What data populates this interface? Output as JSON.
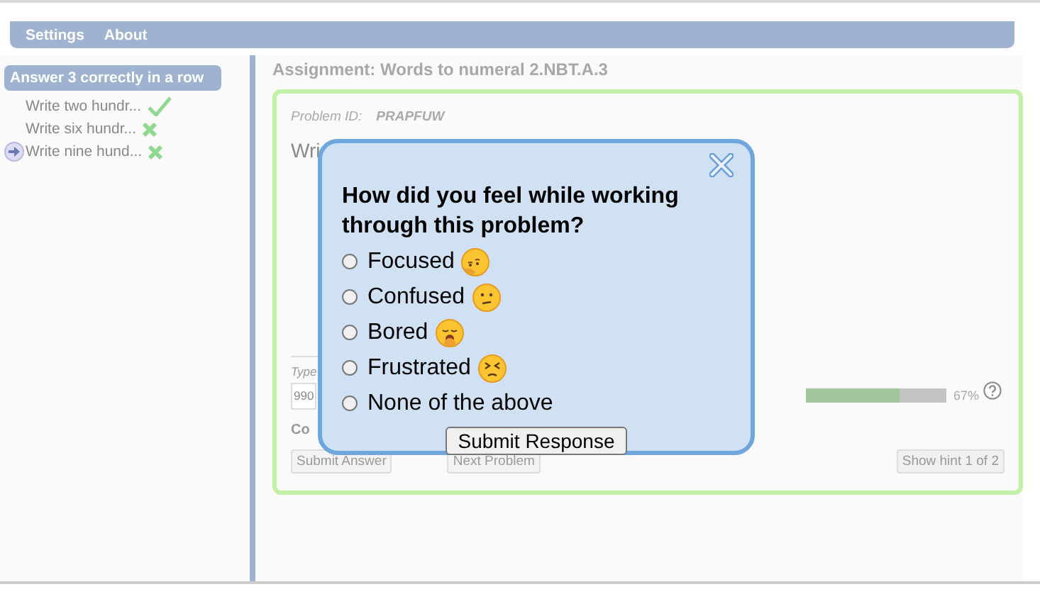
{
  "menu": [
    "Settings",
    "About"
  ],
  "sidebar": {
    "title": "Answer 3 correctly in a row",
    "items": [
      {
        "label": "Write two hundr...",
        "kind": "correct",
        "current": false
      },
      {
        "label": "Write six hundr...",
        "kind": "incorrect",
        "current": false
      },
      {
        "label": "Write nine hund...",
        "kind": "incorrect",
        "current": true
      }
    ]
  },
  "assignment": {
    "title": "Assignment: Words to numeral 2.NBT.A.3",
    "problem_id_label": "Problem ID:",
    "problem_id": "PRAPFUW",
    "question": "Wri",
    "answer_label": "Type",
    "answer_value": "990",
    "feedback": "Co",
    "progress": {
      "level": 0.67,
      "reading": "67%"
    },
    "buttons": [
      {
        "label": "Submit Answer",
        "disabled": true
      },
      {
        "label": "Next Problem",
        "disabled": true
      }
    ],
    "hint_button": "Show hint 1 of 2"
  },
  "dialog": {
    "question": "How did you feel while working through this problem?",
    "options": [
      {
        "label": "Focused",
        "kind": "thinking",
        "selected": false
      },
      {
        "label": "Confused",
        "kind": "confused",
        "selected": false
      },
      {
        "label": "Bored",
        "kind": "yawning",
        "selected": false
      },
      {
        "label": "Frustrated",
        "kind": "persevering",
        "selected": false
      },
      {
        "label": "None of the above",
        "kind": "plain",
        "selected": false
      }
    ],
    "submit": "Submit Response"
  }
}
